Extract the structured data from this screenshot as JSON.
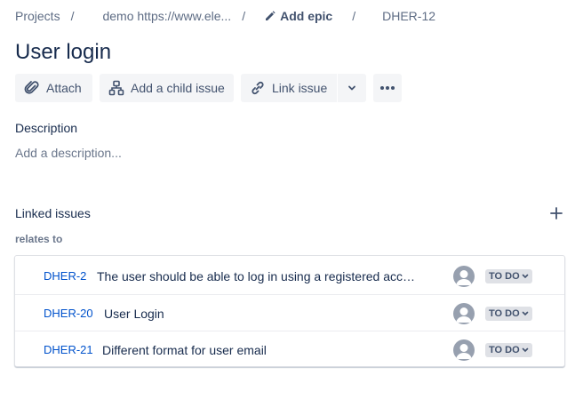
{
  "breadcrumbs": {
    "projects": "Projects",
    "project": "demo https://www.ele...",
    "epic": "Add epic",
    "issue": "DHER-12",
    "separator": "/"
  },
  "issue": {
    "title": "User login"
  },
  "toolbar": {
    "attach": "Attach",
    "add_child": "Add a child issue",
    "link_issue": "Link issue"
  },
  "description": {
    "label": "Description",
    "placeholder": "Add a description..."
  },
  "linked_issues": {
    "label": "Linked issues",
    "relation": "relates to",
    "items": [
      {
        "key": "DHER-2",
        "summary": "The user should be able to log in using a registered acco...",
        "status": "TO DO"
      },
      {
        "key": "DHER-20",
        "summary": "User Login",
        "status": "TO DO"
      },
      {
        "key": "DHER-21",
        "summary": "Different format for user email",
        "status": "TO DO"
      }
    ]
  },
  "colors": {
    "link": "#0052cc",
    "text": "#172b4d",
    "muted": "#6b778c",
    "button_bg": "#f4f5f7",
    "status_bg": "#dfe1e6"
  },
  "icons": [
    "pencil-icon",
    "paperclip-icon",
    "child-issue-icon",
    "link-icon",
    "chevron-down-icon",
    "more-icon",
    "plus-icon",
    "avatar-icon"
  ]
}
